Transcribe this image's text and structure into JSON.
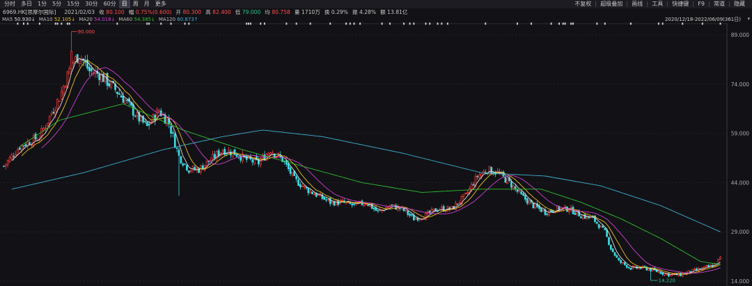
{
  "toolbar": {
    "periods": [
      "分时",
      "多日",
      "1分",
      "5分",
      "15分",
      "30分",
      "60分",
      "日",
      "周",
      "月",
      "更多"
    ],
    "active_period": "日",
    "right_tools": [
      "不复权",
      "超级叠加",
      "画线",
      "工具",
      "快捷键",
      "F9",
      "常道",
      "隐藏"
    ]
  },
  "info": {
    "stock": "6969.HK[思摩尔国际]",
    "date": "2021/02/03",
    "close_label": "收",
    "close": "80.100",
    "change_label": "幅",
    "change": "0.75%(0.600)",
    "open_label": "开",
    "open": "80.300",
    "high_label": "高",
    "high": "82.400",
    "low_label": "低",
    "low": "79.000",
    "avg_label": "均",
    "avg": "80.758",
    "volume_label": "量",
    "volume": "1710万",
    "turnover_label": "换",
    "turnover": "0.29%",
    "amplitude_label": "振",
    "amplitude": "4.28%",
    "amount_label": "额",
    "amount": "13.81亿"
  },
  "ma_legend": [
    {
      "label": "MA5",
      "value": "50.930↓",
      "color": "#e0e0e0"
    },
    {
      "label": "MA10",
      "value": "52.105↓",
      "color": "#f0c020"
    },
    {
      "label": "MA20",
      "value": "54.018↓",
      "color": "#d040d0"
    },
    {
      "label": "MA60",
      "value": "54.385↓",
      "color": "#30c030"
    },
    {
      "label": "MA120",
      "value": "60.873↑",
      "color": "#40b0d0"
    }
  ],
  "date_range": "2020/12/18-2022/06/09(361日)",
  "date_range_dropdown": "▾",
  "colors": {
    "up": "#ff3b3b",
    "down": "#3fd9e0",
    "ma5": "#e0e0e0",
    "ma10": "#f0c020",
    "ma20": "#d040d0",
    "ma60": "#30c030",
    "ma120": "#40b0d0"
  },
  "chart_data": {
    "type": "candlestick",
    "y_ticks": [
      "89.000",
      "74.000",
      "59.000",
      "44.000",
      "29.000",
      "14.000"
    ],
    "ylim": [
      14,
      89
    ],
    "max_label": "90.000",
    "min_label": "14.220",
    "num_candles": 361,
    "close_anchors": [
      [
        0,
        49
      ],
      [
        8,
        55
      ],
      [
        18,
        58
      ],
      [
        28,
        70
      ],
      [
        34,
        80
      ],
      [
        38,
        83
      ],
      [
        43,
        78
      ],
      [
        48,
        77
      ],
      [
        55,
        73
      ],
      [
        61,
        69
      ],
      [
        67,
        64
      ],
      [
        72,
        61
      ],
      [
        78,
        66
      ],
      [
        83,
        62
      ],
      [
        88,
        52
      ],
      [
        93,
        48
      ],
      [
        98,
        48
      ],
      [
        104,
        51
      ],
      [
        110,
        54
      ],
      [
        116,
        53
      ],
      [
        122,
        51
      ],
      [
        128,
        50
      ],
      [
        134,
        54
      ],
      [
        140,
        51
      ],
      [
        146,
        45
      ],
      [
        152,
        42
      ],
      [
        158,
        40
      ],
      [
        164,
        38
      ],
      [
        170,
        38
      ],
      [
        176,
        37
      ],
      [
        182,
        38
      ],
      [
        188,
        35
      ],
      [
        194,
        37
      ],
      [
        200,
        36
      ],
      [
        206,
        33
      ],
      [
        212,
        34
      ],
      [
        218,
        36
      ],
      [
        225,
        36
      ],
      [
        232,
        40
      ],
      [
        238,
        46
      ],
      [
        243,
        48
      ],
      [
        248,
        47
      ],
      [
        254,
        44
      ],
      [
        260,
        40
      ],
      [
        266,
        37
      ],
      [
        272,
        35
      ],
      [
        278,
        36
      ],
      [
        284,
        36
      ],
      [
        290,
        34
      ],
      [
        296,
        33
      ],
      [
        302,
        29
      ],
      [
        305,
        24
      ],
      [
        309,
        20
      ],
      [
        315,
        18
      ],
      [
        322,
        18
      ],
      [
        328,
        17
      ],
      [
        334,
        16
      ],
      [
        340,
        16
      ],
      [
        346,
        17
      ],
      [
        352,
        18
      ],
      [
        357,
        19
      ],
      [
        360,
        21
      ]
    ],
    "ma120_anchors": [
      [
        4,
        42
      ],
      [
        40,
        47
      ],
      [
        80,
        54
      ],
      [
        110,
        58
      ],
      [
        130,
        60
      ],
      [
        160,
        58
      ],
      [
        200,
        53
      ],
      [
        240,
        47
      ],
      [
        272,
        46
      ],
      [
        300,
        43
      ],
      [
        330,
        37
      ],
      [
        360,
        29
      ]
    ],
    "ma60_anchors": [
      [
        8,
        55
      ],
      [
        28,
        63
      ],
      [
        60,
        68
      ],
      [
        90,
        60
      ],
      [
        120,
        54
      ],
      [
        150,
        49
      ],
      [
        180,
        44
      ],
      [
        210,
        41
      ],
      [
        240,
        42
      ],
      [
        270,
        42
      ],
      [
        290,
        38
      ],
      [
        310,
        33
      ],
      [
        330,
        27
      ],
      [
        350,
        20
      ],
      [
        360,
        19
      ]
    ]
  }
}
